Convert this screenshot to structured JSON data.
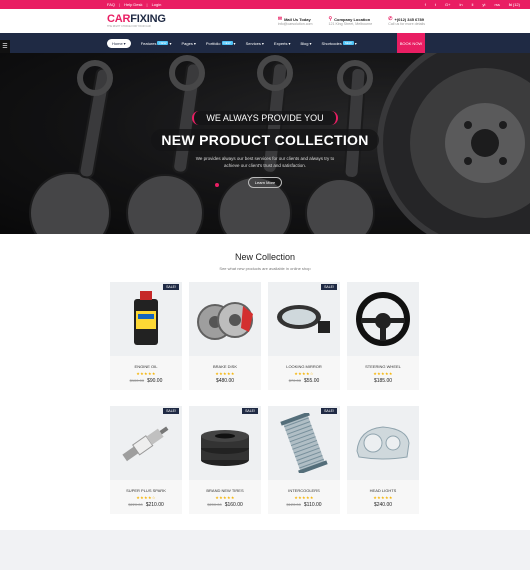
{
  "topbar": {
    "links": [
      "FAQ",
      "Help Desk",
      "Login"
    ],
    "social": [
      "f",
      "t",
      "G+",
      "in",
      "li",
      "yt",
      "rss",
      "₦ (12)"
    ]
  },
  "header": {
    "logo_car": "CAR",
    "logo_fix": "FIXING",
    "logo_tag": "THE RIGHT CHOICE FOR YOUR CAR",
    "mail_title": "Mail Us Today",
    "mail_value": "info@carsolution.com",
    "location_title": "Company Location",
    "location_value": "121 King Street, Melbourne",
    "phone_title": "+(012) 345 6789",
    "phone_value": "Call us for more details"
  },
  "nav": {
    "items": [
      {
        "label": "Home",
        "badge": ""
      },
      {
        "label": "Features",
        "badge": "NEW"
      },
      {
        "label": "Pages",
        "badge": ""
      },
      {
        "label": "Portfolio",
        "badge": "NEW"
      },
      {
        "label": "Services",
        "badge": ""
      },
      {
        "label": "Experts",
        "badge": ""
      },
      {
        "label": "Blog",
        "badge": ""
      },
      {
        "label": "Shortcodes",
        "badge": "NEW"
      }
    ],
    "book_label": "BOOK NOW"
  },
  "hero": {
    "subtitle": "WE ALWAYS PROVIDE YOU",
    "title": "NEW PRODUCT COLLECTION",
    "description": "We provides always our best services for our clients and always try to achieve our client's trust and satisfaction.",
    "button": "Learn More"
  },
  "collection": {
    "title": "New Collection",
    "subtitle": "See what new products are available in online shop",
    "sale_label": "SALE!",
    "products": [
      {
        "name": "ENGINE OIL",
        "old": "$100.00",
        "price": "$90.00",
        "sale": true,
        "stars": "★★★★★"
      },
      {
        "name": "BRAKE DISK",
        "old": "",
        "price": "$480.00",
        "sale": false,
        "stars": "★★★★★"
      },
      {
        "name": "LOOKING MIRROR",
        "old": "$70.00",
        "price": "$55.00",
        "sale": true,
        "stars": "★★★★☆"
      },
      {
        "name": "STEERING WHEEL",
        "old": "",
        "price": "$185.00",
        "sale": false,
        "stars": "★★★★★"
      },
      {
        "name": "SUPER PLUS SPARK",
        "old": "$220.00",
        "price": "$210.00",
        "sale": true,
        "stars": "★★★★☆"
      },
      {
        "name": "BRAND NEW TIRES",
        "old": "$200.00",
        "price": "$160.00",
        "sale": true,
        "stars": "★★★★★"
      },
      {
        "name": "INTERCOOLERS",
        "old": "$120.00",
        "price": "$110.00",
        "sale": true,
        "stars": "★★★★★"
      },
      {
        "name": "HEAD LIGHTS",
        "old": "",
        "price": "$240.00",
        "sale": false,
        "stars": "★★★★★"
      }
    ]
  },
  "colors": {
    "accent": "#e91e63",
    "navy": "#1f2a44"
  }
}
